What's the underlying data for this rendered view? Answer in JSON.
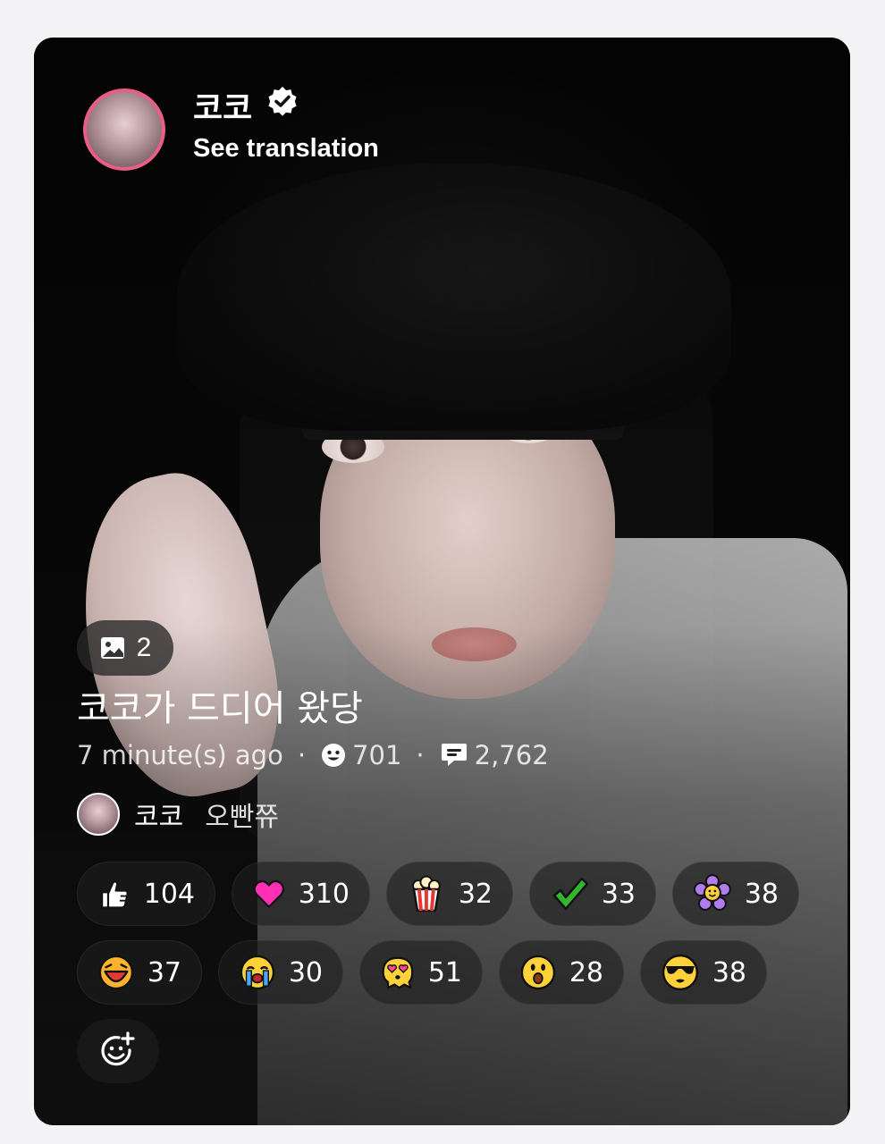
{
  "post": {
    "author_name": "코코",
    "see_translation": "See translation",
    "image_count": "2",
    "caption": "코코가 드디어 왔당",
    "time_ago": "7 minute(s) ago",
    "separator": "·",
    "reaction_total": "701",
    "comment_total": "2,762"
  },
  "comment": {
    "author": "코코",
    "text": "오빤쮸"
  },
  "reactions": [
    {
      "icon": "thumbs-up-icon",
      "count": "104"
    },
    {
      "icon": "heart-icon",
      "count": "310"
    },
    {
      "icon": "popcorn-icon",
      "count": "32"
    },
    {
      "icon": "checkmark-icon",
      "count": "33"
    },
    {
      "icon": "flower-icon",
      "count": "38"
    },
    {
      "icon": "laughing-face-icon",
      "count": "37"
    },
    {
      "icon": "crying-face-icon",
      "count": "30"
    },
    {
      "icon": "heart-eyes-face-icon",
      "count": "51"
    },
    {
      "icon": "surprised-face-icon",
      "count": "28"
    },
    {
      "icon": "sunglasses-face-icon",
      "count": "38"
    }
  ],
  "colors": {
    "avatar_ring": "#ea5e86",
    "heart": "#ff2fb3",
    "check": "#33b52d",
    "flower": "#b07cf0",
    "emoji_yellow": "#ffd23a"
  }
}
